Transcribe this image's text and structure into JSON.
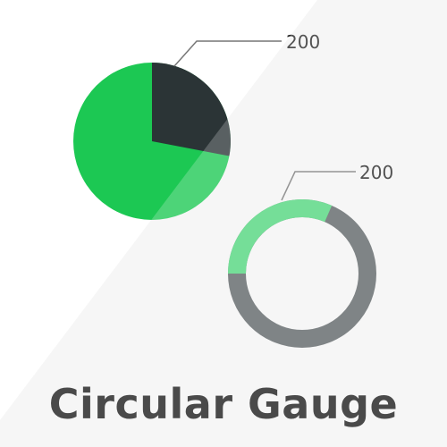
{
  "title": "Circular Gauge",
  "colors": {
    "green": "#1cc853",
    "green_light": "#4fd57b",
    "dark": "#2b3436",
    "gray": "#5c6264",
    "background_tint": "#f5f5f5"
  },
  "pie_gauge": {
    "callout_value": "200",
    "dark_fraction": 0.28
  },
  "ring_gauge": {
    "callout_value": "200",
    "green_fraction": 0.22
  }
}
